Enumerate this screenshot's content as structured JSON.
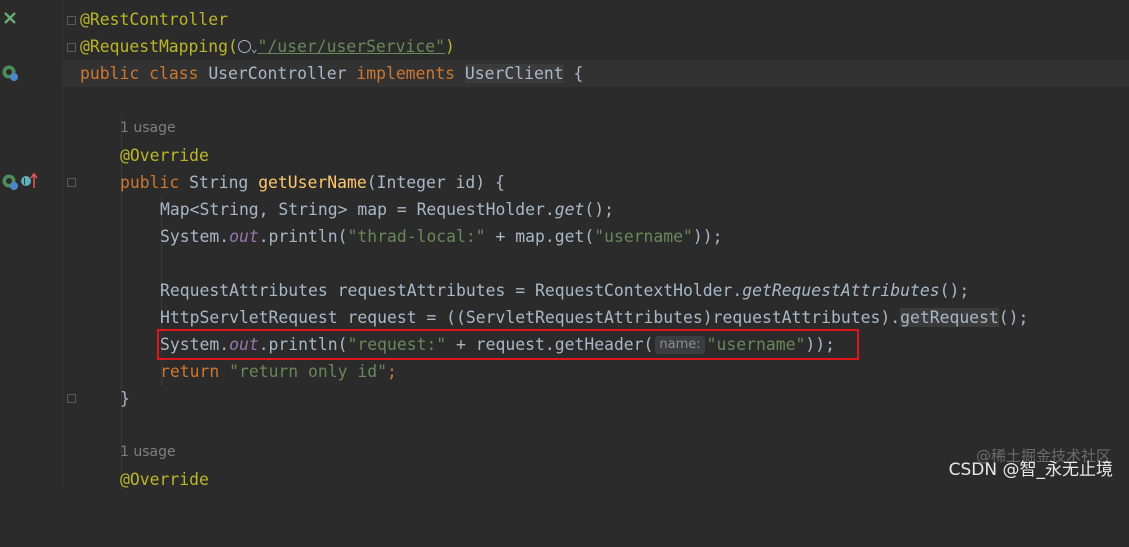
{
  "editor": {
    "lines": {
      "l1": {
        "annotation": "@RestController"
      },
      "l2": {
        "annotation": "@RequestMapping(",
        "path": "\"/user/userService\"",
        "close": ")"
      },
      "l3": {
        "kw1": "public",
        "kw2": "class",
        "name": "UserController",
        "kw3": "implements",
        "iface": "UserClient",
        "brace": "{"
      },
      "usage1": "1 usage",
      "l5": {
        "annotation": "@Override"
      },
      "l6": {
        "kw": "public",
        "type": "String",
        "method": "getUserName",
        "params": "(Integer id) {"
      },
      "l7": {
        "pre": "Map<String, String> map = RequestHolder.",
        "call": "get",
        "post": "();"
      },
      "l8": {
        "pre": "System.",
        "out": "out",
        "mid": ".println(",
        "str1": "\"thrad-local:\"",
        "mid2": " + map.get(",
        "str2": "\"username\"",
        "post": "));"
      },
      "l10": {
        "pre": "RequestAttributes requestAttributes = RequestContextHolder.",
        "call": "getRequestAttributes",
        "post": "();"
      },
      "l11": {
        "pre": "HttpServletRequest request = ((ServletRequestAttributes)requestAttributes).",
        "call": "getRequest",
        "post": "();"
      },
      "l12": {
        "pre": "System.",
        "out": "out",
        "mid": ".println(",
        "str1": "\"request:\"",
        "mid2": " + request.getHeader(",
        "hint": "name:",
        "str2": "\"username\"",
        "post": "));"
      },
      "l13": {
        "kw": "return",
        "str": "\"return only id\"",
        "post": ";"
      },
      "l14": {
        "brace": "}"
      },
      "usage2": "1 usage",
      "l16": {
        "annotation": "@Override"
      }
    }
  },
  "icons": {
    "gutter_bean_1": "spring-bean-icon",
    "gutter_bean_2": "spring-web-icon",
    "gutter_bean_3": "spring-web-icon",
    "gutter_impl": "implements-method-icon"
  },
  "watermark": {
    "main": "CSDN @智_永无止境",
    "shadow": "@稀土掘金技术社区"
  },
  "colors": {
    "background": "#2b2b2b",
    "keyword": "#cc7832",
    "annotation": "#bbb529",
    "string": "#6a8759",
    "method": "#ffc66d",
    "static_field": "#9876aa",
    "highlight_box": "#e0161b"
  }
}
